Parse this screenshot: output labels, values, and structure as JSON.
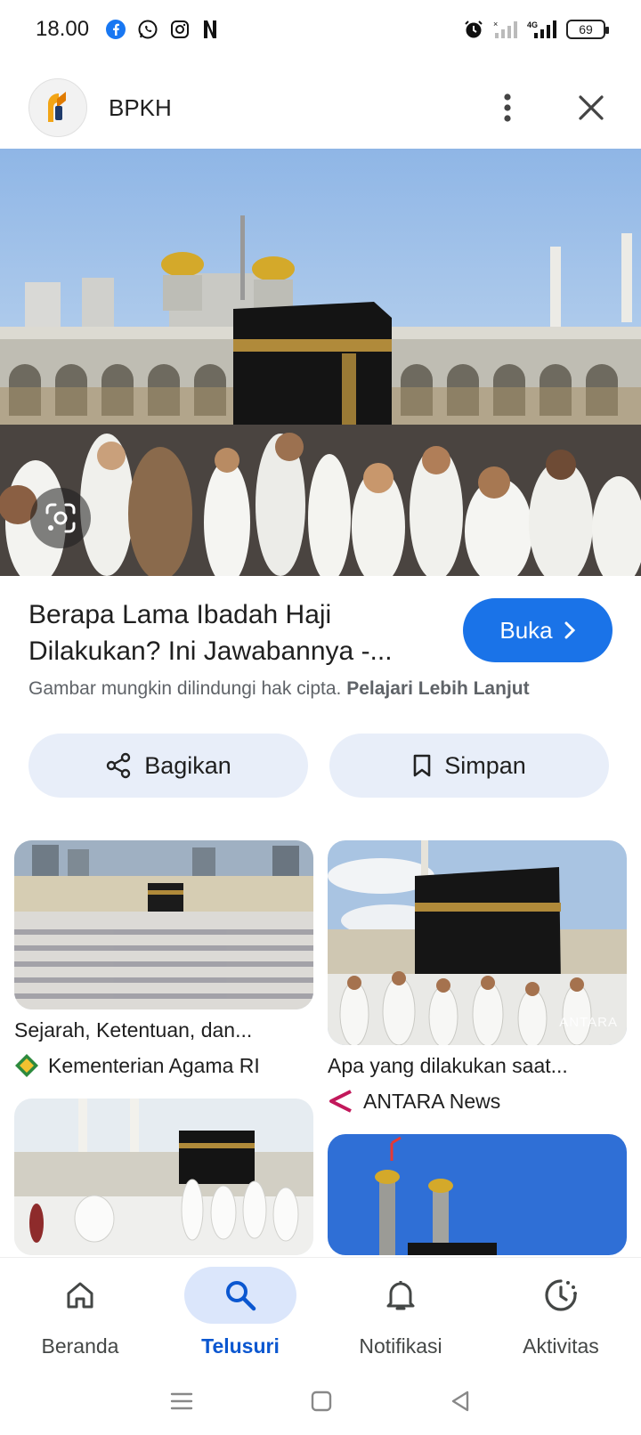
{
  "status_bar": {
    "time": "18.00",
    "left_icons": [
      "facebook-icon",
      "whatsapp-icon",
      "instagram-icon",
      "netflix-icon"
    ],
    "right_icons": [
      "alarm-icon",
      "signal-empty-icon",
      "signal-4g-icon"
    ],
    "network": "4G",
    "battery": "69"
  },
  "header": {
    "site_name": "BPKH"
  },
  "result": {
    "title": "Berapa Lama Ibadah Haji Dilakukan? Ini Jawabannya -...",
    "open_label": "Buka",
    "copyright_text": "Gambar mungkin dilindungi hak cipta.",
    "learn_more": "Pelajari Lebih Lanjut"
  },
  "actions": {
    "share_label": "Bagikan",
    "save_label": "Simpan"
  },
  "related": [
    {
      "title": "Sejarah, Ketentuan, dan...",
      "source": "Kementerian Agama RI"
    },
    {
      "title": "Apa yang dilakukan saat...",
      "source": "ANTARA News",
      "watermark": "ANTARA"
    },
    {
      "title": "",
      "source": ""
    },
    {
      "title": "",
      "source": ""
    }
  ],
  "bottom_nav": {
    "items": [
      {
        "label": "Beranda",
        "icon": "home-icon"
      },
      {
        "label": "Telusuri",
        "icon": "search-icon",
        "active": true
      },
      {
        "label": "Notifikasi",
        "icon": "bell-icon"
      },
      {
        "label": "Aktivitas",
        "icon": "activity-icon"
      }
    ]
  },
  "colors": {
    "accent": "#1a73e8",
    "active_nav": "#0b57d0",
    "pill_bg": "#e8eef9"
  }
}
